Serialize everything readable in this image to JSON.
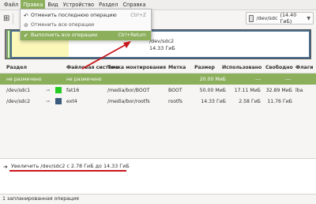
{
  "menubar": {
    "items": [
      "Файл",
      "Правка",
      "Вид",
      "Устройство",
      "Раздел",
      "Справка"
    ]
  },
  "device_selector": {
    "device": "/dev/sdc",
    "size": "(14.40 ГиБ)"
  },
  "graph": {
    "partition": "/dev/sdc2",
    "size": "14.33 ГиБ"
  },
  "table": {
    "columns": [
      "Раздел",
      "Файловая система",
      "Точка монтирования",
      "Метка",
      "Размер",
      "Использовано",
      "Свободно",
      "Флаги"
    ],
    "rows": [
      {
        "partition": "не размечено",
        "filesystem": "не размечено",
        "mount": "",
        "label": "",
        "size": "20.00 МиБ",
        "used": "---",
        "free": "---",
        "flags": "",
        "swatch": "#a3a3a3"
      },
      {
        "partition": "/dev/sdc1",
        "filesystem": "fat16",
        "mount": "/media/bor/BOOT",
        "label": "BOOT",
        "size": "50.00 МиБ",
        "used": "17.11 МиБ",
        "free": "32.89 МиБ",
        "flags": "lba",
        "swatch": "#22cc22"
      },
      {
        "partition": "/dev/sdc2",
        "filesystem": "ext4",
        "mount": "/media/bor/rootfs",
        "label": "rootfs",
        "size": "14.33 ГиБ",
        "used": "2.58 ГиБ",
        "free": "11.76 ГиБ",
        "flags": "",
        "swatch": "#3b5b7d"
      }
    ]
  },
  "operations": {
    "items": [
      "Увеличить /dev/sdc2 с 2.78 ГиБ до 14.33 ГиБ"
    ]
  },
  "status": {
    "text": "1 запланированная операция"
  },
  "edit_menu": {
    "items": [
      {
        "label": "Отменить последнюю операцию",
        "shortcut": "Ctrl+Z"
      },
      {
        "label": "Отменить все операции",
        "shortcut": ""
      },
      {
        "label": "Выполнить все операции",
        "shortcut": "Ctrl+Return"
      }
    ]
  },
  "colors": {
    "accent": "#8caf5c",
    "annotation": "#c9181d"
  }
}
